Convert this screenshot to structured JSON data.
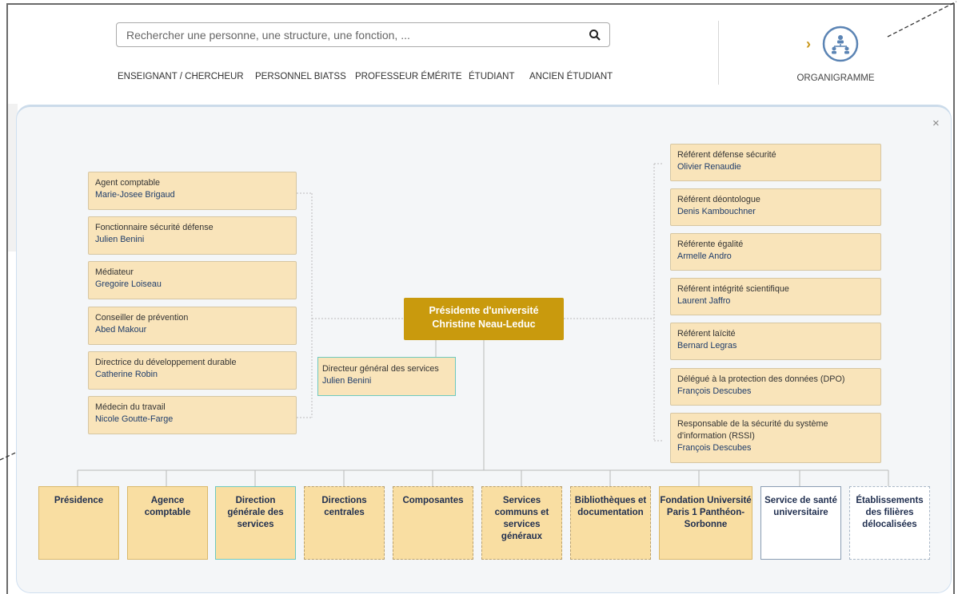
{
  "search": {
    "placeholder": "Rechercher une personne, une structure, une fonction, ..."
  },
  "nav": [
    "ENSEIGNANT / CHERCHEUR",
    "PERSONNEL BIATSS",
    "PROFESSEUR ÉMÉRITE",
    "ÉTUDIANT",
    "ANCIEN ÉTUDIANT"
  ],
  "org": {
    "label": "ORGANIGRAMME"
  },
  "close": "×",
  "president": {
    "role": "Présidente d'université",
    "name": "Christine Neau-Leduc"
  },
  "dgs": {
    "role": "Directeur général des services",
    "name": "Julien Benini"
  },
  "left_boxes": [
    {
      "role": "Agent comptable",
      "name": "Marie-Josee Brigaud"
    },
    {
      "role": "Fonctionnaire sécurité défense",
      "name": "Julien Benini"
    },
    {
      "role": "Médiateur",
      "name": "Gregoire Loiseau"
    },
    {
      "role": "Conseiller de prévention",
      "name": "Abed Makour"
    },
    {
      "role": "Directrice du développement durable",
      "name": "Catherine Robin"
    },
    {
      "role": "Médecin du travail",
      "name": "Nicole Goutte-Farge"
    }
  ],
  "right_boxes": [
    {
      "role": "Référent défense sécurité",
      "name": "Olivier Renaudie"
    },
    {
      "role": "Référent déontologue",
      "name": "Denis Kambouchner"
    },
    {
      "role": "Référente égalité",
      "name": "Armelle Andro"
    },
    {
      "role": "Référent intégrité scientifique",
      "name": "Laurent Jaffro"
    },
    {
      "role": "Référent laïcité",
      "name": "Bernard Legras"
    },
    {
      "role": "Délégué à la protection des données (DPO)",
      "name": "François Descubes"
    },
    {
      "role": "Responsable de la sécurité du système d'information (RSSI)",
      "name": "François Descubes"
    }
  ],
  "bottom": [
    "Présidence",
    "Agence comptable",
    "Direction générale des services",
    "Directions centrales",
    "Composantes",
    "Services communs et services généraux",
    "Bibliothèques et documentation",
    "Fondation Université Paris 1 Panthéon-Sorbonne",
    "Service de santé universitaire",
    "Établissements des filières délocalisées"
  ],
  "colors": {
    "accent": "#c99a0d",
    "box": "#f9e4ba",
    "teal": "#6ec9bf",
    "name": "#1f3d6b"
  }
}
